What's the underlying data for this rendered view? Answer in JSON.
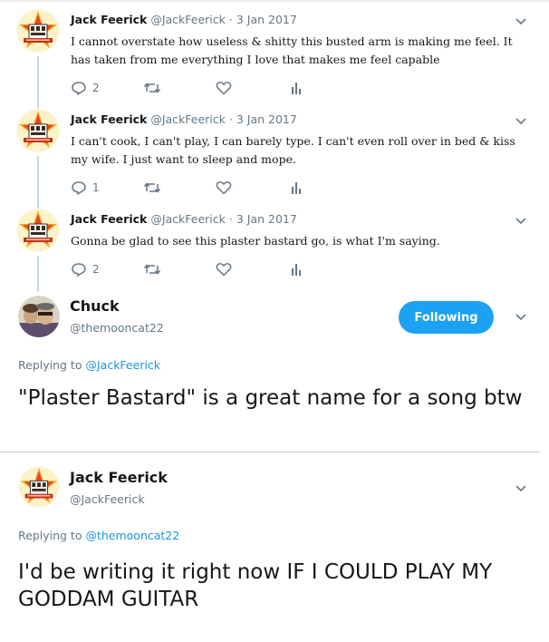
{
  "colors": {
    "accent": "#1da1f2",
    "link": "#1b95e0",
    "secondary": "#657786",
    "thread_line": "#c4d9e9"
  },
  "thread": [
    {
      "name": "Jack Feerick",
      "handle": "@JackFeerick",
      "separator": "·",
      "date": "3 Jan 2017",
      "text": "I cannot overstate how useless & shitty this busted arm is making me feel. It has taken from me everything I love that makes me feel capable",
      "reply_count": "2"
    },
    {
      "name": "Jack Feerick",
      "handle": "@JackFeerick",
      "separator": "·",
      "date": "3 Jan 2017",
      "text": "I can't cook, I can't play, I can barely type. I can't even roll over in bed & kiss my wife. I just want to sleep and mope.",
      "reply_count": "1"
    },
    {
      "name": "Jack Feerick",
      "handle": "@JackFeerick",
      "separator": "·",
      "date": "3 Jan 2017",
      "text": "Gonna be glad to see this plaster bastard go, is what I'm saying.",
      "reply_count": "2"
    }
  ],
  "reply1": {
    "name": "Chuck",
    "handle": "@themooncat22",
    "follow_label": "Following",
    "replying_prefix": "Replying to",
    "replying_to": "@JackFeerick",
    "text": "\"Plaster Bastard\" is a great name for a song btw"
  },
  "reply2": {
    "name": "Jack Feerick",
    "handle": "@JackFeerick",
    "replying_prefix": "Replying to",
    "replying_to": "@themooncat22",
    "text": "I'd be writing it right now IF I COULD PLAY MY GODDAM GUITAR"
  }
}
